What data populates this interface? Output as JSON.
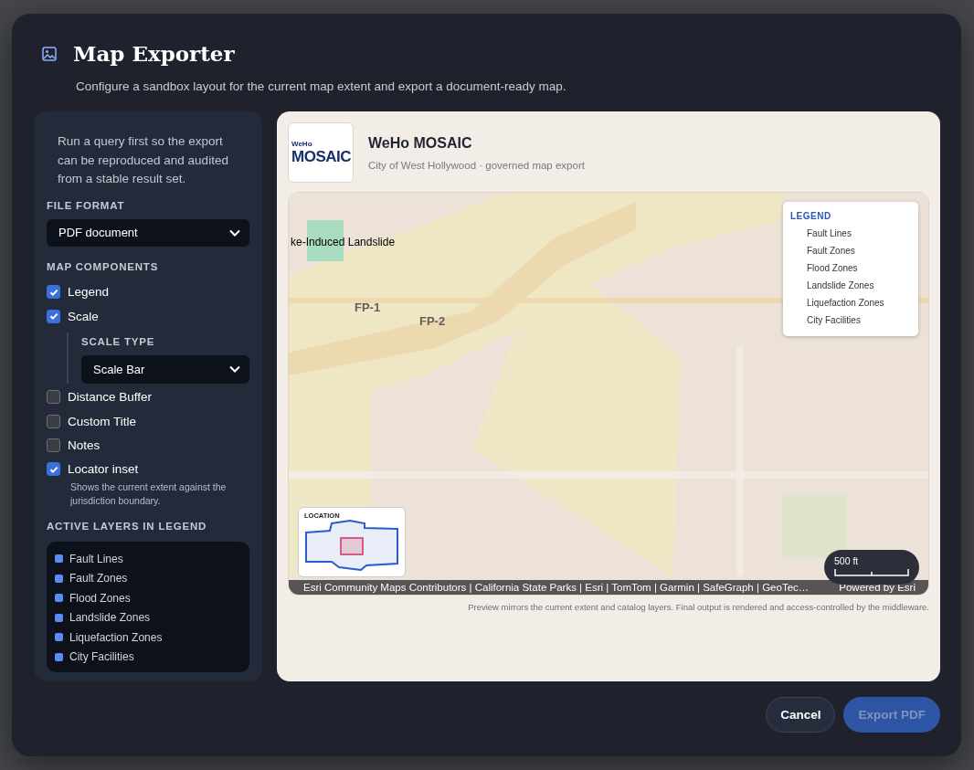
{
  "dialog": {
    "title": "Map Exporter",
    "subtitle": "Configure a sandbox layout for the current map extent and export a document-ready map."
  },
  "sidebar": {
    "notice": "Run a query first so the export can be reproduced and audited from a stable result set.",
    "file_format": {
      "label": "FILE FORMAT",
      "value": "PDF document"
    },
    "components_label": "MAP COMPONENTS",
    "components": [
      {
        "label": "Legend",
        "checked": true
      },
      {
        "label": "Scale",
        "checked": true,
        "sub": {
          "label": "SCALE TYPE",
          "value": "Scale Bar"
        }
      },
      {
        "label": "Distance Buffer",
        "checked": false
      },
      {
        "label": "Custom Title",
        "checked": false
      },
      {
        "label": "Notes",
        "checked": false
      },
      {
        "label": "Locator inset",
        "checked": true,
        "hint": "Shows the current extent against the jurisdiction boundary."
      }
    ],
    "layers_label": "ACTIVE LAYERS IN LEGEND",
    "layers": [
      {
        "name": "Fault Lines",
        "color": "#5b8cf5"
      },
      {
        "name": "Fault Zones",
        "color": "#5b8cf5"
      },
      {
        "name": "Flood Zones",
        "color": "#5b8cf5"
      },
      {
        "name": "Landslide Zones",
        "color": "#5b8cf5"
      },
      {
        "name": "Liquefaction Zones",
        "color": "#5b8cf5"
      },
      {
        "name": "City Facilities",
        "color": "#5b8cf5"
      }
    ]
  },
  "preview": {
    "brand": {
      "logo_small": "WeHo",
      "logo": "MOSAIC",
      "name": "WeHo MOSAIC",
      "tagline": "City of West Hollywood · governed map export"
    },
    "map": {
      "feature_labels": [
        {
          "text": "ke-Induced Landslide",
          "kind": "halo"
        },
        {
          "text": "FP-1",
          "kind": "zone"
        },
        {
          "text": "FP-2",
          "kind": "zone"
        }
      ],
      "legend": {
        "title": "LEGEND",
        "items": [
          "Fault Lines",
          "Fault Zones",
          "Flood Zones",
          "Landslide Zones",
          "Liquefaction Zones",
          "City Facilities"
        ]
      },
      "locator": {
        "title": "LOCATION"
      },
      "scale": {
        "label": "500 ft"
      },
      "attribution": "Esri Community Maps Contributors | California State Parks | Esri | TomTom | Garmin | SafeGraph | GeoTec…",
      "powered": "Powered by Esri"
    },
    "footnote": "Preview mirrors the current extent and catalog layers. Final output is rendered and access-controlled by the middleware."
  },
  "buttons": [
    {
      "label": "Cancel",
      "kind": "secondary",
      "disabled": false
    },
    {
      "label": "Export PDF",
      "kind": "primary",
      "disabled": true
    }
  ]
}
